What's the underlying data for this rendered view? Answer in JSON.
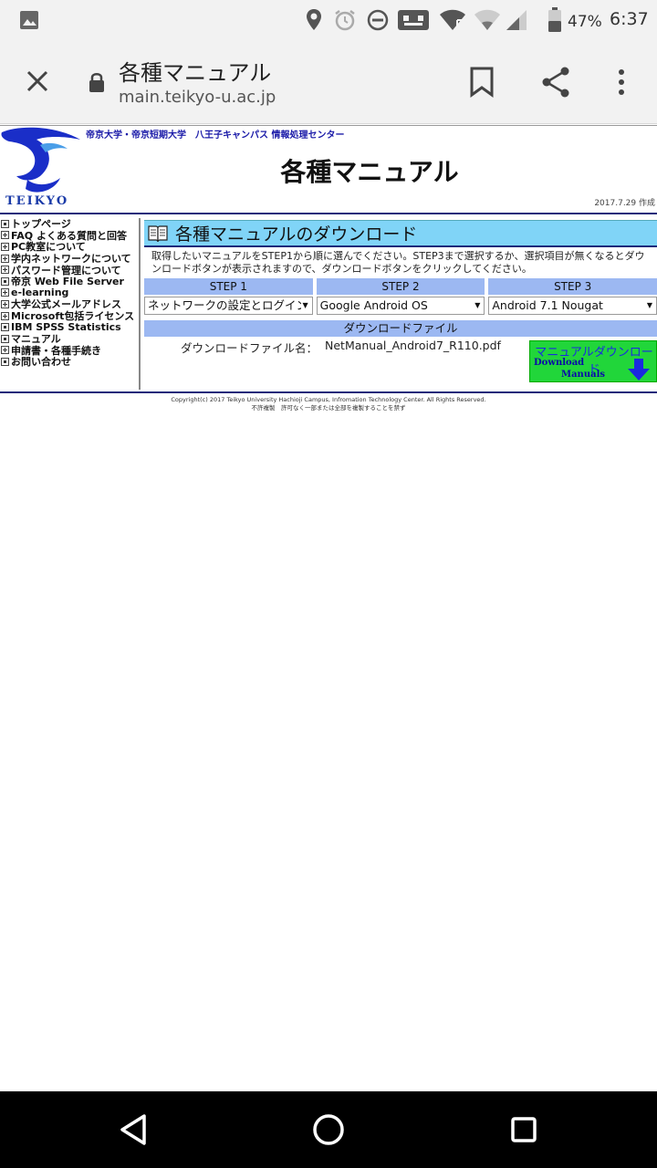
{
  "status_bar": {
    "battery": "47%",
    "time": "6:37"
  },
  "browser": {
    "page_title": "各種マニュアル",
    "url": "main.teikyo-u.ac.jp"
  },
  "header": {
    "university_line": "帝京大学・帝京短期大学　八王子キャンパス 情報処理センター",
    "logo_text": "TEIKYO",
    "heading": "各種マニュアル",
    "date": "2017.7.29 作成"
  },
  "sidebar": {
    "items": [
      {
        "label": "トップページ",
        "box": "dot"
      },
      {
        "label": "FAQ よくある質問と回答",
        "box": "plus"
      },
      {
        "label": "PC教室について",
        "box": "plus"
      },
      {
        "label": "学内ネットワークについて",
        "box": "plus"
      },
      {
        "label": "パスワード管理について",
        "box": "plus"
      },
      {
        "label": "帝京 Web File Server",
        "box": "dot"
      },
      {
        "label": "e-learning",
        "box": "plus"
      },
      {
        "label": "大学公式メールアドレス",
        "box": "plus"
      },
      {
        "label": "Microsoft包括ライセンス",
        "box": "plus"
      },
      {
        "label": "IBM SPSS Statistics",
        "box": "dot"
      },
      {
        "label": "マニュアル",
        "box": "dot"
      },
      {
        "label": "申請書・各種手続き",
        "box": "plus"
      },
      {
        "label": "お問い合わせ",
        "box": "dot"
      }
    ]
  },
  "main": {
    "section_title": "各種マニュアルのダウンロード",
    "instructions": "取得したいマニュアルをSTEP1から順に選んでください。STEP3まで選択するか、選択項目が無くなるとダウンロードボタンが表示されますので、ダウンロードボタンをクリックしてください。",
    "steps": [
      {
        "header": "STEP 1",
        "value": "ネットワークの設定とログイン"
      },
      {
        "header": "STEP 2",
        "value": "Google Android OS"
      },
      {
        "header": "STEP 3",
        "value": "Android 7.1 Nougat"
      }
    ],
    "download": {
      "header": "ダウンロードファイル",
      "label": "ダウンロードファイル名：",
      "filename": "NetManual_Android7_R110.pdf",
      "button_line1": "マニュアルダウンロード",
      "button_line2": "Download",
      "button_line3": "Manuals"
    }
  },
  "footer": {
    "copyright": "Copyright(c) 2017 Teikyo University Hachioji Campus, Infromation Technology Center. All Rights Reserved.",
    "notice": "不許複製　許可なく一部または全部を複製することを禁ず"
  },
  "colors": {
    "accent_blue": "#1a2a7a",
    "section_bg": "#80d4f7",
    "step_bg": "#9cb8f2",
    "download_button": "#21d63a"
  }
}
